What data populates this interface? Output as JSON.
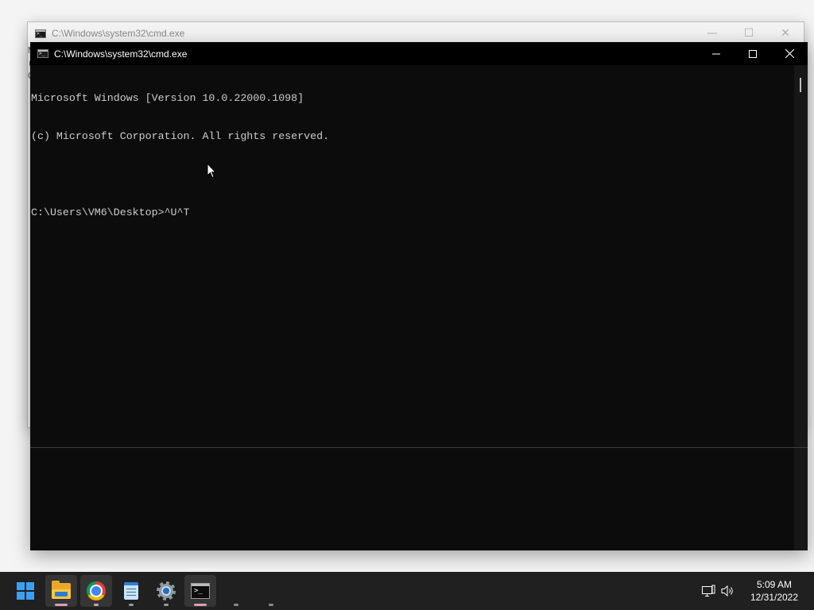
{
  "back_window": {
    "title": "C:\\Windows\\system32\\cmd.exe",
    "edge_chars": [
      "M",
      "(",
      "",
      "C"
    ]
  },
  "front_window": {
    "title": "C:\\Windows\\system32\\cmd.exe",
    "minimize_glyph": "—",
    "maximize_glyph": "☐",
    "close_glyph": "✕",
    "console_lines": [
      "Microsoft Windows [Version 10.0.22000.1098]",
      "(c) Microsoft Corporation. All rights reserved.",
      "",
      "C:\\Users\\VM6\\Desktop>^U^T"
    ]
  },
  "taskbar": {
    "apps": [
      {
        "icon": "start-icon"
      },
      {
        "icon": "file-explorer-icon"
      },
      {
        "icon": "chrome-icon"
      },
      {
        "icon": "notepad-icon"
      },
      {
        "icon": "settings-gear-icon"
      },
      {
        "icon": "command-prompt-icon"
      }
    ],
    "clock_time": "5:09 AM",
    "clock_date": "12/31/2022",
    "tray_icons": [
      "network-icon",
      "volume-icon"
    ]
  },
  "colors": {
    "console_bg": "#0c0c0c",
    "console_text": "#cccccc",
    "taskbar_bg": "#202020",
    "start_blue": "#3aa0f3"
  }
}
